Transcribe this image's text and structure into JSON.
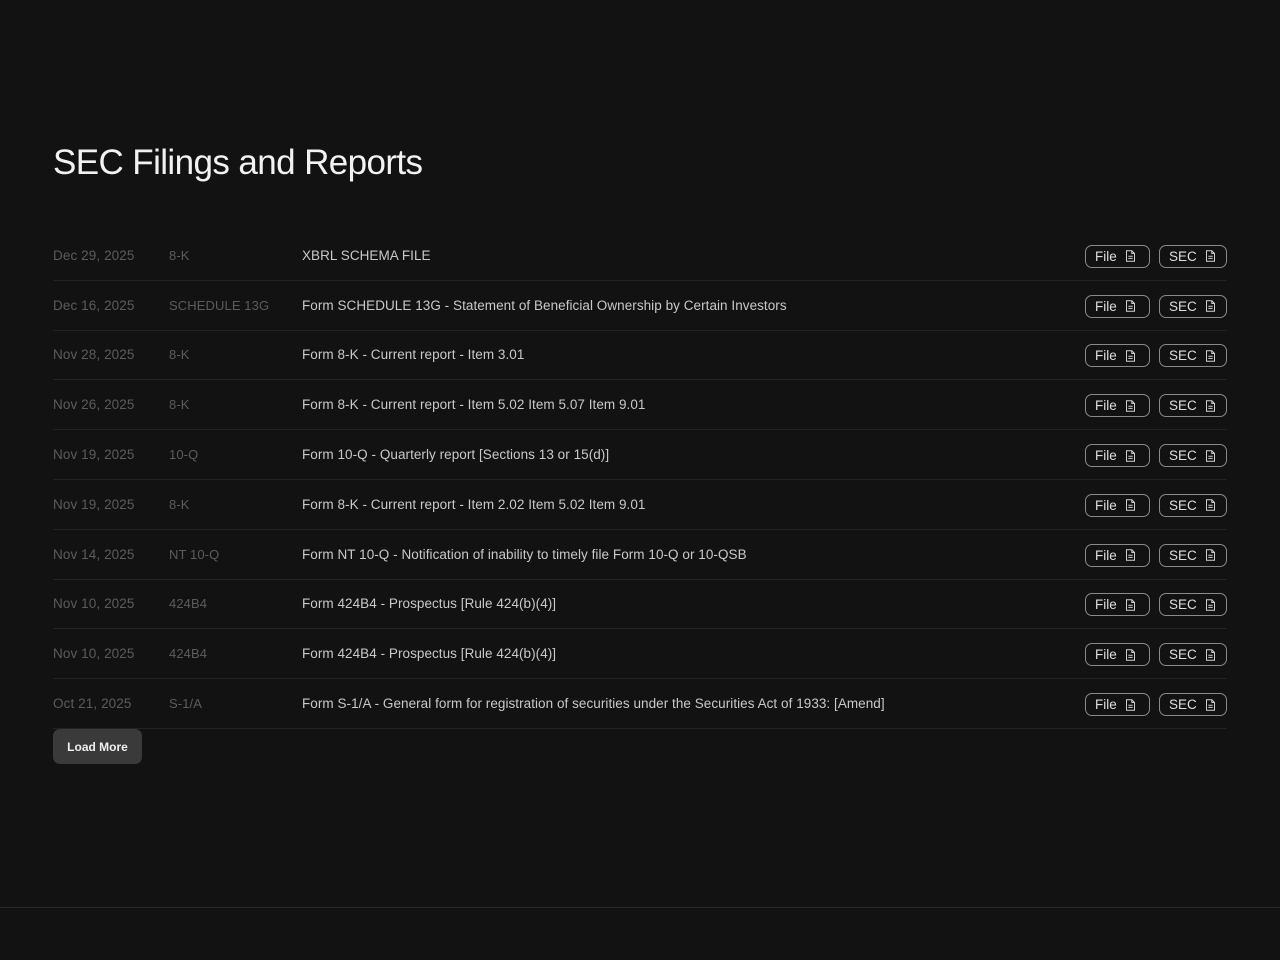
{
  "page": {
    "title": "SEC Filings and Reports",
    "load_more_label": "Load More"
  },
  "filings": [
    {
      "date": "Dec 29, 2025",
      "type": "8-K",
      "description": "XBRL SCHEMA FILE",
      "file_label": "File",
      "sec_label": "SEC"
    },
    {
      "date": "Dec 16, 2025",
      "type": "SCHEDULE 13G",
      "description": "Form SCHEDULE 13G - Statement of Beneficial Ownership by Certain Investors",
      "file_label": "File",
      "sec_label": "SEC"
    },
    {
      "date": "Nov 28, 2025",
      "type": "8-K",
      "description": "Form 8-K - Current report - Item 3.01",
      "file_label": "File",
      "sec_label": "SEC"
    },
    {
      "date": "Nov 26, 2025",
      "type": "8-K",
      "description": "Form 8-K - Current report - Item 5.02 Item 5.07 Item 9.01",
      "file_label": "File",
      "sec_label": "SEC"
    },
    {
      "date": "Nov 19, 2025",
      "type": "10-Q",
      "description": "Form 10-Q - Quarterly report [Sections 13 or 15(d)]",
      "file_label": "File",
      "sec_label": "SEC"
    },
    {
      "date": "Nov 19, 2025",
      "type": "8-K",
      "description": "Form 8-K - Current report - Item 2.02 Item 5.02 Item 9.01",
      "file_label": "File",
      "sec_label": "SEC"
    },
    {
      "date": "Nov 14, 2025",
      "type": "NT 10-Q",
      "description": "Form NT 10-Q - Notification of inability to timely file Form 10-Q or 10-QSB",
      "file_label": "File",
      "sec_label": "SEC"
    },
    {
      "date": "Nov 10, 2025",
      "type": "424B4",
      "description": "Form 424B4 - Prospectus [Rule 424(b)(4)]",
      "file_label": "File",
      "sec_label": "SEC"
    },
    {
      "date": "Nov 10, 2025",
      "type": "424B4",
      "description": "Form 424B4 - Prospectus [Rule 424(b)(4)]",
      "file_label": "File",
      "sec_label": "SEC"
    },
    {
      "date": "Oct 21, 2025",
      "type": "S-1/A",
      "description": "Form S-1/A - General form for registration of securities under the Securities Act of 1933: [Amend]",
      "file_label": "File",
      "sec_label": "SEC"
    }
  ],
  "icons": {
    "file_button_icon": "document-icon",
    "sec_button_icon": "document-icon"
  },
  "colors": {
    "background": "#121212",
    "button_border": "#8a8a8a",
    "load_more_bg": "#3a3a3a"
  }
}
